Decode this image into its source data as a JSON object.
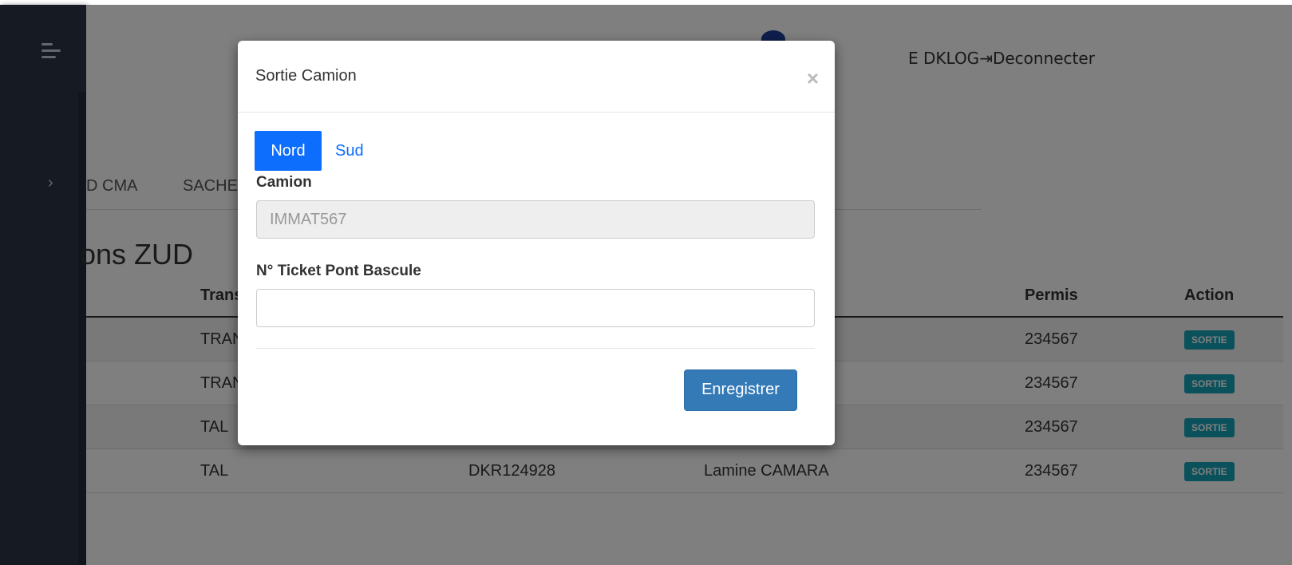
{
  "header": {
    "user_text": "E DKLOG",
    "logout_icon": "logout-icon",
    "logout_label": "Deconnecter"
  },
  "tabs": [
    "D CMA",
    "SACHE"
  ],
  "page_title": "ons ZUD",
  "table": {
    "headers": {
      "transporter": "Trans",
      "permis": "Permis",
      "action": "Action"
    },
    "rows": [
      {
        "transporter": "TRAN",
        "immat": "",
        "driver": "",
        "permis": "234567",
        "action": "SORTIE"
      },
      {
        "transporter": "TRAN",
        "immat": "",
        "driver": "",
        "permis": "234567",
        "action": "SORTIE"
      },
      {
        "transporter": "TAL",
        "immat": "",
        "driver": "",
        "permis": "234567",
        "action": "SORTIE"
      },
      {
        "transporter": "TAL",
        "immat": "DKR124928",
        "driver": "Lamine CAMARA",
        "permis": "234567",
        "action": "SORTIE"
      }
    ]
  },
  "modal": {
    "title": "Sortie Camion",
    "close_glyph": "×",
    "pills": {
      "active": "Nord",
      "other": "Sud"
    },
    "camion_label": "Camion",
    "camion_value": "IMMAT567",
    "ticket_label": "N° Ticket Pont Bascule",
    "ticket_value": "",
    "save_label": "Enregistrer"
  },
  "colors": {
    "primary": "#0d6efd",
    "save": "#337ab7",
    "badge": "#17a2b8",
    "sidebar": "#2b3446"
  }
}
